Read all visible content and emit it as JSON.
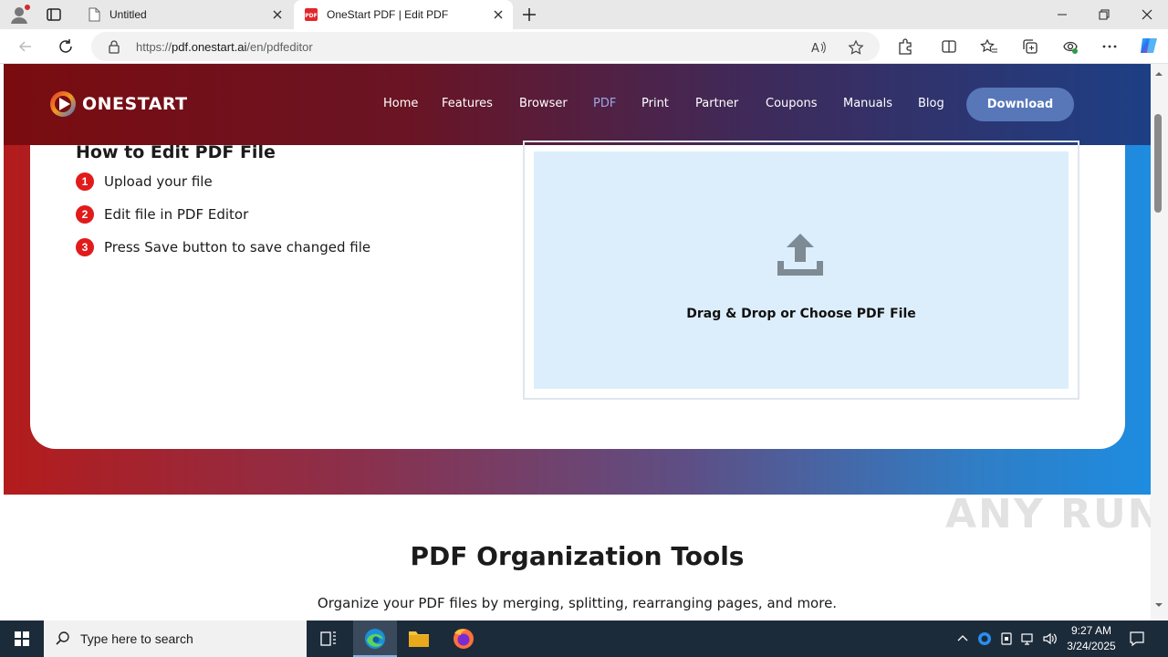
{
  "browser": {
    "tabs": [
      {
        "title": "Untitled",
        "active": false
      },
      {
        "title": "OneStart PDF | Edit PDF",
        "active": true
      }
    ],
    "url_prefix": "https://",
    "url_host": "pdf.onestart.ai",
    "url_path": "/en/pdfeditor"
  },
  "site": {
    "brand": "ONESTART",
    "nav": [
      "Home",
      "Features",
      "Browser",
      "PDF",
      "Print",
      "Partner",
      "Coupons",
      "Manuals",
      "Blog"
    ],
    "active_nav": "PDF",
    "download_label": "Download",
    "howto": {
      "title": "How to Edit PDF File",
      "steps": [
        {
          "num": "1",
          "text": "Upload your file"
        },
        {
          "num": "2",
          "text": "Edit file in PDF Editor"
        },
        {
          "num": "3",
          "text": "Press Save button to save changed file"
        }
      ]
    },
    "dropzone_text": "Drag & Drop or Choose PDF File",
    "tools_title": "PDF Organization Tools",
    "tools_subtitle": "Organize your PDF files by merging, splitting, rearranging pages, and more."
  },
  "watermark": "ANY RUN",
  "taskbar": {
    "search_placeholder": "Type here to search",
    "time": "9:27 AM",
    "date": "3/24/2025"
  },
  "colors": {
    "accent_red": "#e11b1b",
    "nav_active": "#9ca8e8",
    "download_button": "#5777b8",
    "dropzone_bg": "#dceefb"
  }
}
